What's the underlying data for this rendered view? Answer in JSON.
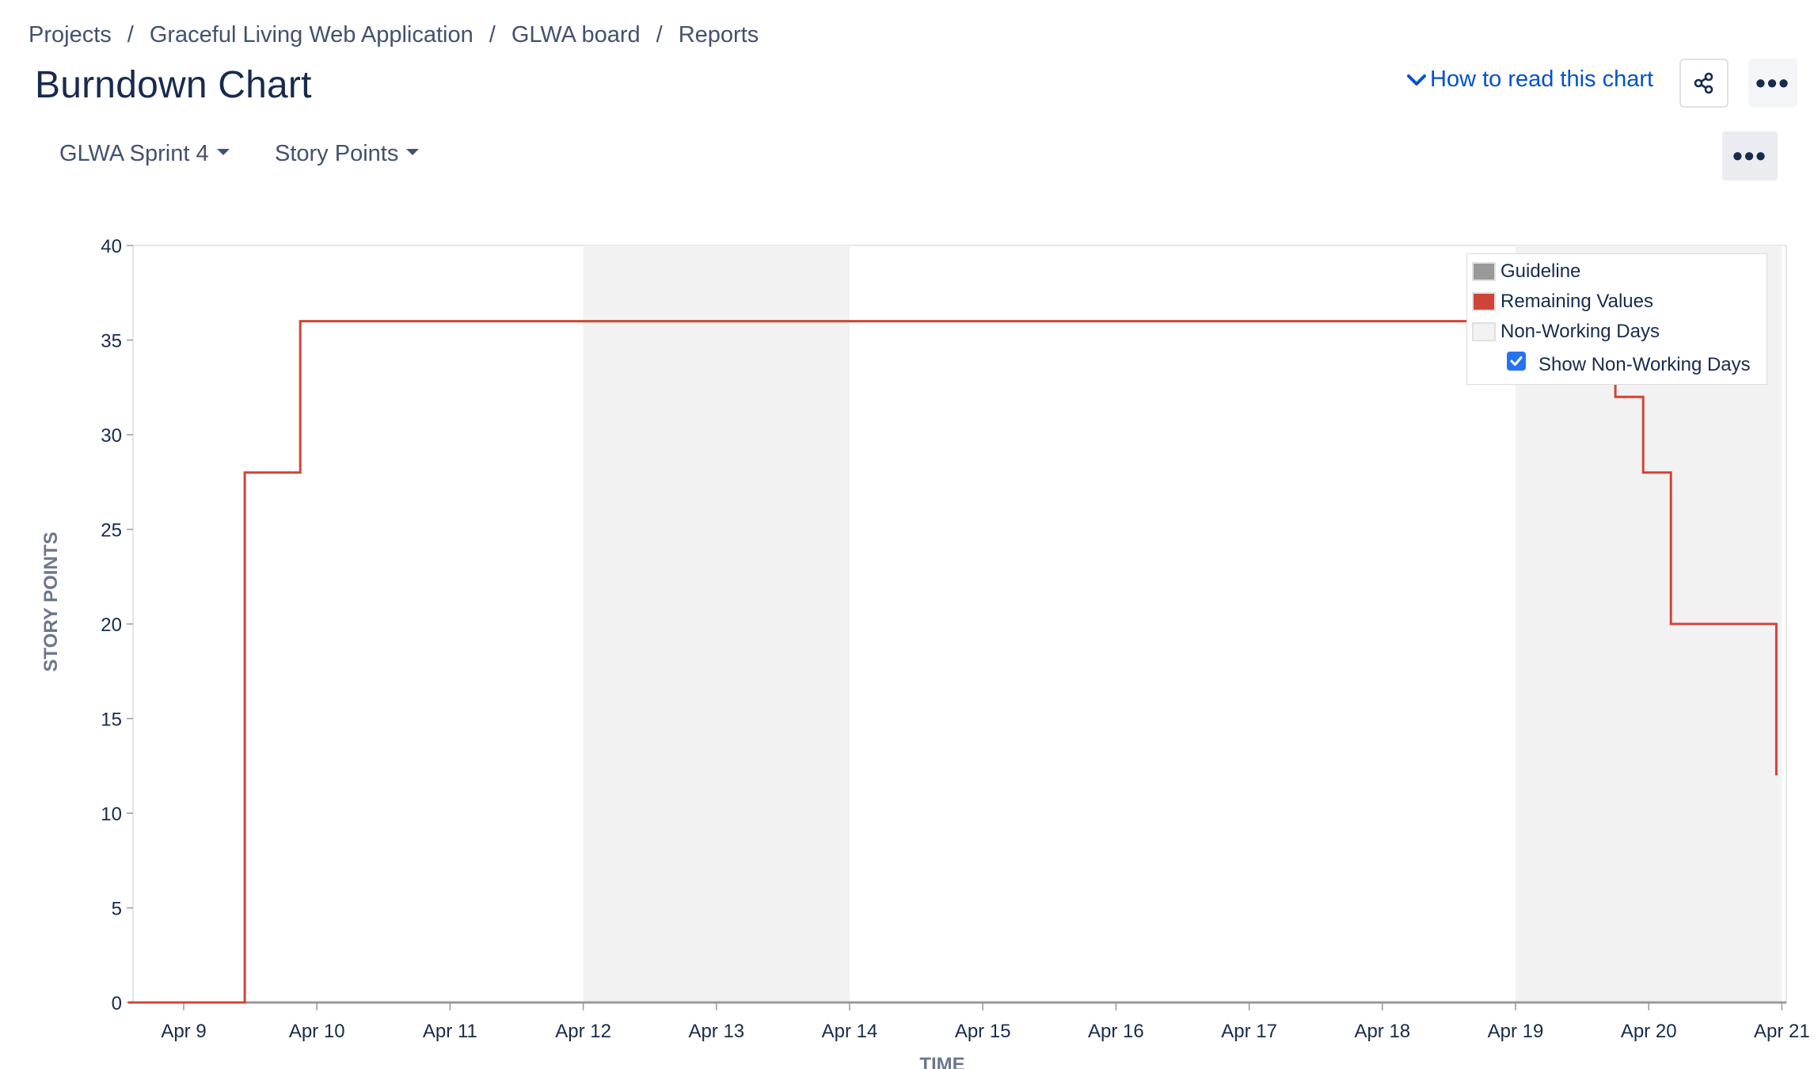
{
  "breadcrumb": [
    "Projects",
    "Graceful Living Web Application",
    "GLWA board",
    "Reports"
  ],
  "page_title": "Burndown Chart",
  "how_to_read": "How to read this chart",
  "selectors": {
    "sprint": "GLWA Sprint 4",
    "estimation": "Story Points"
  },
  "legend": {
    "guideline": "Guideline",
    "remaining": "Remaining Values",
    "non_working": "Non-Working Days",
    "show_non_working": "Show Non-Working Days",
    "show_non_working_checked": true
  },
  "colors": {
    "remaining": "#d04437",
    "guideline": "#999999",
    "non_working": "#f2f2f2",
    "link": "#0052cc",
    "checkbox": "#2672f0"
  },
  "chart_data": {
    "type": "line",
    "step": true,
    "xlabel": "TIME",
    "ylabel": "STORY POINTS",
    "ylim": [
      0,
      40
    ],
    "yticks": [
      0,
      5,
      10,
      15,
      20,
      25,
      30,
      35,
      40
    ],
    "xticks": [
      "Apr 9",
      "Apr 10",
      "Apr 11",
      "Apr 12",
      "Apr 13",
      "Apr 14",
      "Apr 15",
      "Apr 16",
      "Apr 17",
      "Apr 18",
      "Apr 19",
      "Apr 20",
      "Apr 21"
    ],
    "non_working_days": [
      [
        "Apr 12",
        "Apr 14"
      ],
      [
        "Apr 19",
        "Apr 21"
      ]
    ],
    "show_non_working_days": true,
    "series": [
      {
        "name": "Remaining Values",
        "points": [
          [
            "Apr 8 14:00",
            0
          ],
          [
            "Apr 9 11:00",
            0
          ],
          [
            "Apr 9 11:00",
            8
          ],
          [
            "Apr 9 11:00",
            23
          ],
          [
            "Apr 9 11:00",
            28
          ],
          [
            "Apr 9 21:00",
            28
          ],
          [
            "Apr 9 21:00",
            36
          ],
          [
            "Apr 19 18:00",
            36
          ],
          [
            "Apr 19 18:00",
            32
          ],
          [
            "Apr 19 23:00",
            32
          ],
          [
            "Apr 19 23:00",
            28
          ],
          [
            "Apr 20 04:00",
            28
          ],
          [
            "Apr 20 04:00",
            20
          ],
          [
            "Apr 20 23:00",
            20
          ],
          [
            "Apr 20 23:00",
            12
          ]
        ]
      },
      {
        "name": "Guideline",
        "points": []
      }
    ]
  }
}
